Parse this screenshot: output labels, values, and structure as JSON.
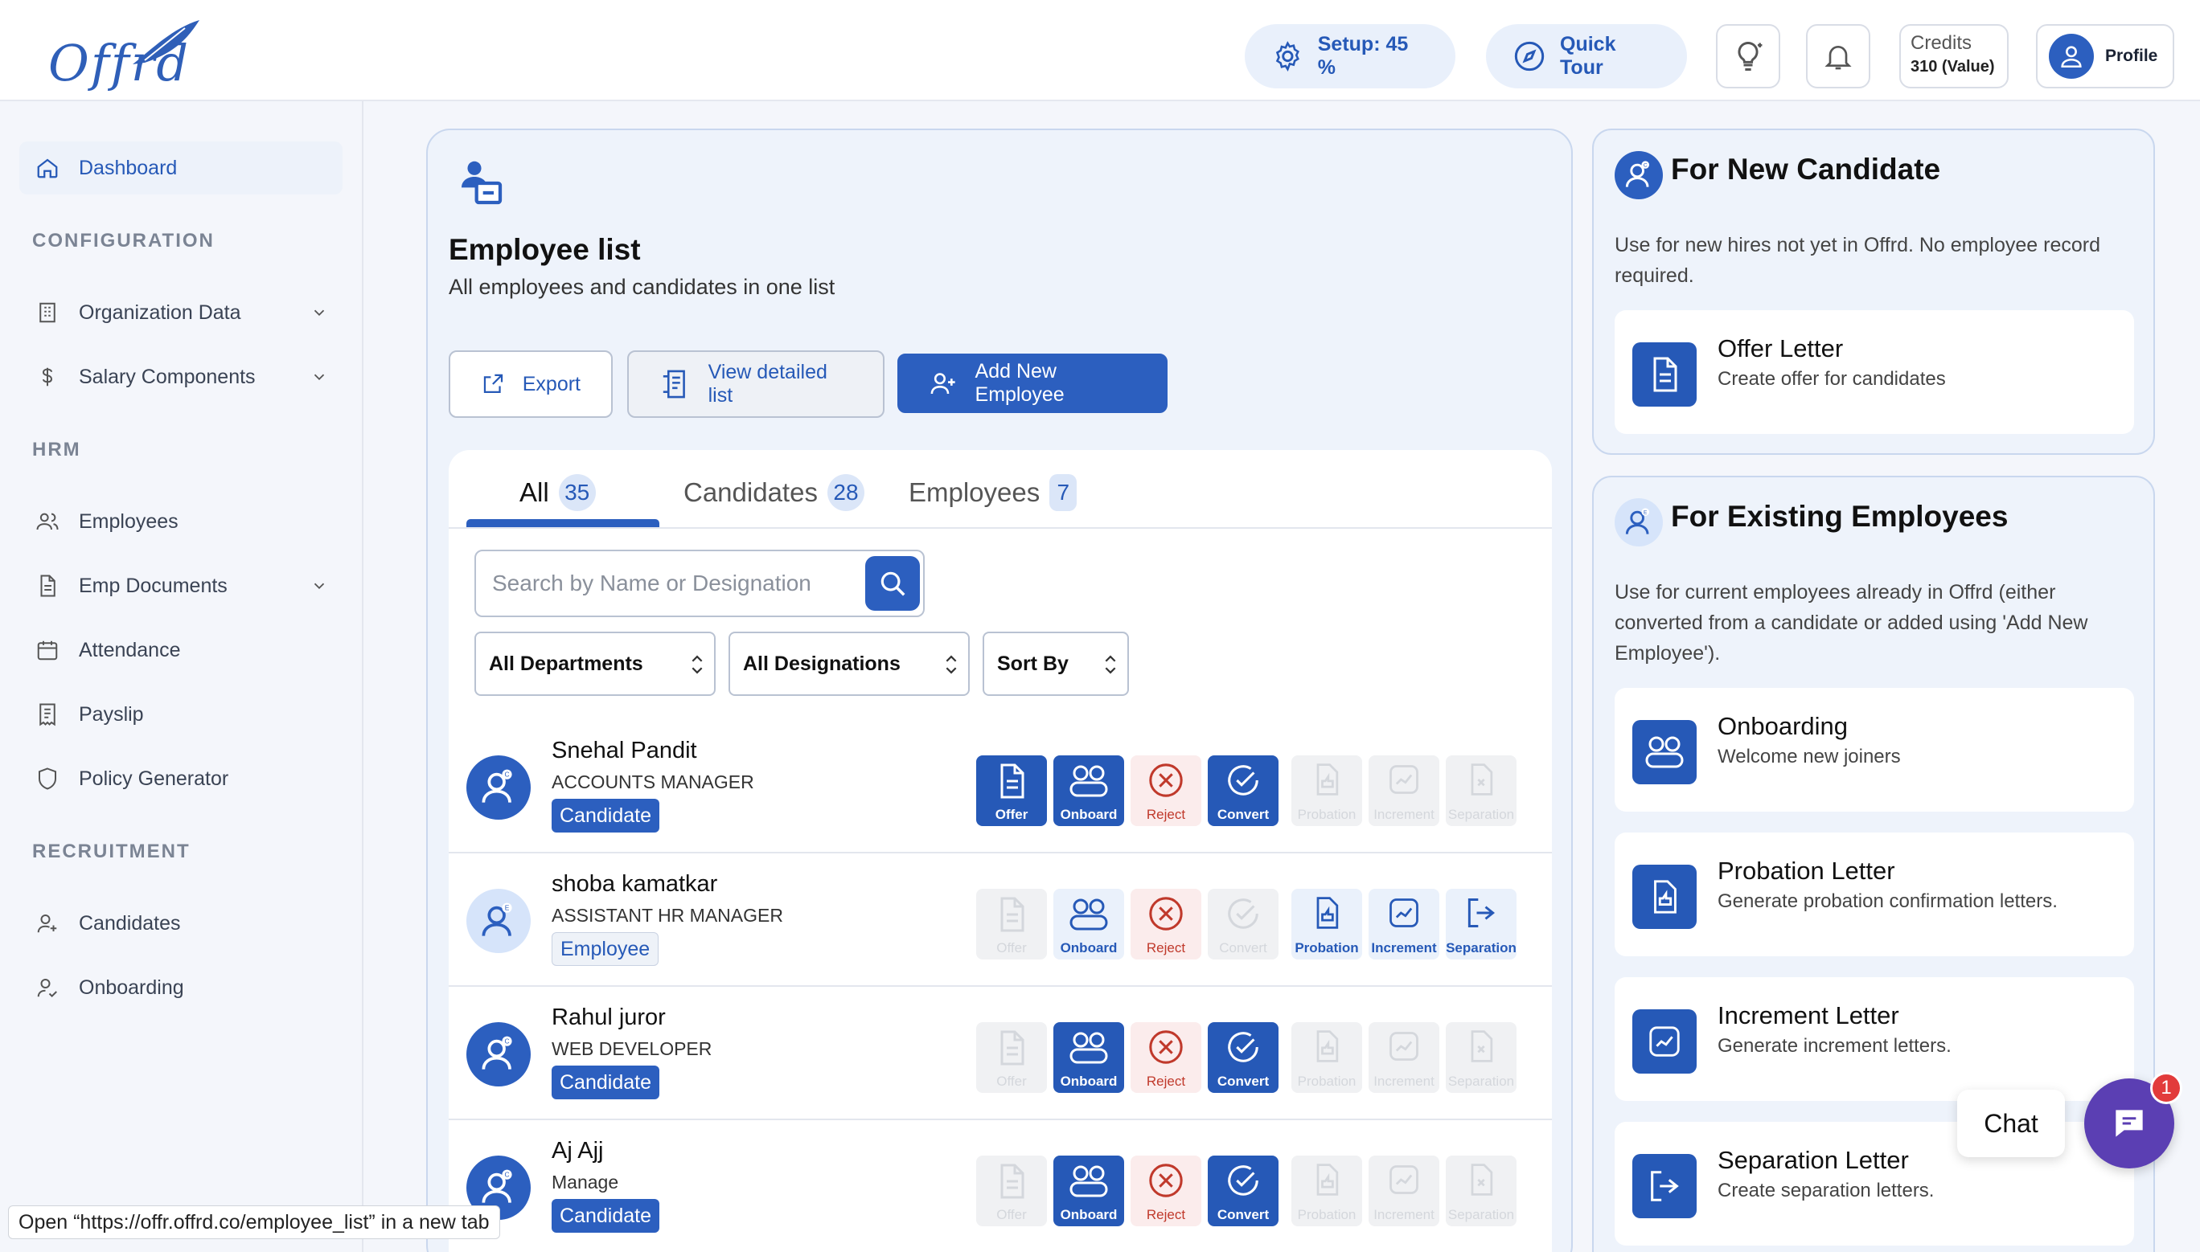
{
  "topbar": {
    "logo_text": "Offrd",
    "setup_label": "Setup: 45 %",
    "tour_label": "Quick Tour",
    "credits_label": "Credits",
    "credits_value": "310 (Value)",
    "profile_label": "Profile"
  },
  "sidebar": {
    "dashboard": "Dashboard",
    "sections": {
      "config": "CONFIGURATION",
      "hrm": "HRM",
      "recruitment": "RECRUITMENT"
    },
    "items": {
      "org": "Organization Data",
      "salary": "Salary Components",
      "employees": "Employees",
      "docs": "Emp Documents",
      "attendance": "Attendance",
      "payslip": "Payslip",
      "policy": "Policy Generator",
      "candidates": "Candidates",
      "onboarding": "Onboarding"
    }
  },
  "main": {
    "title": "Employee list",
    "subtitle": "All employees and candidates in one list",
    "export_label": "Export",
    "view_detailed_label": "View detailed list",
    "add_label": "Add New Employee",
    "tabs": [
      {
        "label": "All",
        "count": "35"
      },
      {
        "label": "Candidates",
        "count": "28"
      },
      {
        "label": "Employees",
        "count": "7"
      }
    ],
    "search_placeholder": "Search by Name or Designation",
    "filters": {
      "dept": "All Departments",
      "desig": "All Designations",
      "sort": "Sort By"
    },
    "action_labels": {
      "offer": "Offer",
      "onboard": "Onboard",
      "reject": "Reject",
      "convert": "Convert",
      "probation": "Probation",
      "increment": "Increment",
      "separation": "Separation"
    },
    "rows": [
      {
        "name": "Snehal Pandit",
        "role": "ACCOUNTS MANAGER",
        "type": "Candidate"
      },
      {
        "name": "shoba kamatkar",
        "role": "ASSISTANT HR MANAGER",
        "type": "Employee"
      },
      {
        "name": "Rahul juror",
        "role": "WEB DEVELOPER",
        "type": "Candidate"
      },
      {
        "name": "Aj Ajj",
        "role": "Manage",
        "type": "Candidate"
      }
    ]
  },
  "new_candidate": {
    "title": "For New Candidate",
    "desc": "Use for new hires not yet in Offrd. No employee record required.",
    "offer_title": "Offer Letter",
    "offer_sub": "Create offer for candidates"
  },
  "existing": {
    "title": "For Existing Employees",
    "desc": "Use for current employees already in Offrd (either converted from a candidate or added using 'Add New Employee').",
    "items": [
      {
        "title": "Onboarding",
        "sub": "Welcome new joiners"
      },
      {
        "title": "Probation Letter",
        "sub": "Generate probation confirmation letters."
      },
      {
        "title": "Increment Letter",
        "sub": "Generate increment letters."
      },
      {
        "title": "Separation Letter",
        "sub": "Create separation letters."
      }
    ]
  },
  "chat": {
    "label": "Chat",
    "badge": "1"
  },
  "status": {
    "text": "Open “https://offr.offrd.co/employee_list” in a new tab"
  },
  "colors": {
    "primary": "#2c5fbf",
    "reject": "#c0392b",
    "chat": "#5b3fb3"
  }
}
